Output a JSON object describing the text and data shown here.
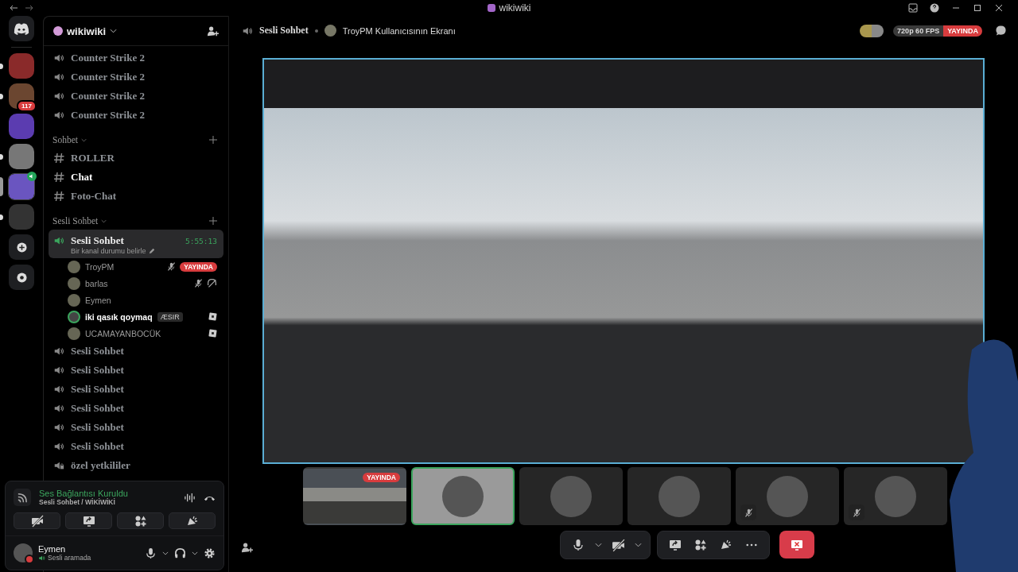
{
  "window": {
    "title": "wikiwiki"
  },
  "servers": [
    {
      "selected": false,
      "unread": true,
      "in_voice": false
    },
    {
      "selected": false,
      "unread": true,
      "in_voice": false,
      "badge": "117"
    },
    {
      "selected": false,
      "unread": false,
      "in_voice": false
    },
    {
      "selected": false,
      "unread": true,
      "in_voice": false
    },
    {
      "selected": true,
      "unread": false,
      "in_voice": true
    },
    {
      "selected": false,
      "unread": true,
      "in_voice": false
    }
  ],
  "sidebar": {
    "server_name": "wikiwiki",
    "channels": [
      {
        "kind": "voice",
        "name": "Counter Strike 2",
        "selected": false
      },
      {
        "kind": "voice",
        "name": "Counter Strike 2",
        "selected": false
      },
      {
        "kind": "voice",
        "name": "Counter Strike 2",
        "selected": false
      },
      {
        "kind": "voice",
        "name": "Counter Strike 2",
        "selected": false
      },
      {
        "kind": "category",
        "name": "Sohbet"
      },
      {
        "kind": "text",
        "name": "ROLLER",
        "unread": false
      },
      {
        "kind": "text",
        "name": "Chat",
        "unread": true
      },
      {
        "kind": "text",
        "name": "Foto-Chat",
        "unread": false
      },
      {
        "kind": "category",
        "name": "Sesli Sohbet"
      },
      {
        "kind": "voice",
        "name": "Sesli Sohbet",
        "selected": true,
        "timer": "5:55:13",
        "status": "Bir kanal durumu belirle",
        "members": [
          {
            "name": "TroyPM",
            "speaking": false,
            "muted": true,
            "camera_off": false,
            "activity": false,
            "live": "YAYINDA"
          },
          {
            "name": "barlas",
            "speaking": false,
            "muted": true,
            "camera_off": true,
            "activity": false
          },
          {
            "name": "Eymen",
            "speaking": false,
            "muted": false,
            "camera_off": false,
            "activity": false
          },
          {
            "name": "iki qasık qoymaq",
            "speaking": true,
            "muted": false,
            "camera_off": false,
            "activity": true,
            "tag": "ÆSIR"
          },
          {
            "name": "UCAMAYANBOCÜK",
            "speaking": false,
            "muted": false,
            "camera_off": false,
            "activity": true
          }
        ]
      },
      {
        "kind": "voice",
        "name": "Sesli Sohbet",
        "selected": false
      },
      {
        "kind": "voice",
        "name": "Sesli Sohbet",
        "selected": false
      },
      {
        "kind": "voice",
        "name": "Sesli Sohbet",
        "selected": false
      },
      {
        "kind": "voice",
        "name": "Sesli Sohbet",
        "selected": false
      },
      {
        "kind": "voice",
        "name": "Sesli Sohbet",
        "selected": false
      },
      {
        "kind": "voice",
        "name": "Sesli Sohbet",
        "selected": false
      },
      {
        "kind": "voice_locked",
        "name": "özel yetkililer"
      }
    ]
  },
  "voice_panel": {
    "status": "Ses Bağlantısı Kuruldu",
    "location": "Sesli Sohbet / WİKİWİKİ"
  },
  "user": {
    "name": "Eymen",
    "status": "Sesli aramada",
    "dnd": true
  },
  "header": {
    "channel": "Sesli Sohbet",
    "stream_title": "TroyPM Kullanıcısının Ekranı",
    "quality": "720p 60 FPS",
    "live": "YAYINDA"
  },
  "tiles": [
    {
      "kind": "stream",
      "selected": false,
      "muted": false,
      "badge": "YAYINDA"
    },
    {
      "kind": "avatar",
      "selected": true,
      "muted": false
    },
    {
      "kind": "avatar",
      "selected": false,
      "muted": false
    },
    {
      "kind": "avatar",
      "selected": false,
      "muted": false
    },
    {
      "kind": "avatar",
      "selected": false,
      "muted": true
    },
    {
      "kind": "avatar",
      "selected": false,
      "muted": true
    }
  ],
  "controls": {
    "mic_muted": false,
    "camera_off": true
  }
}
